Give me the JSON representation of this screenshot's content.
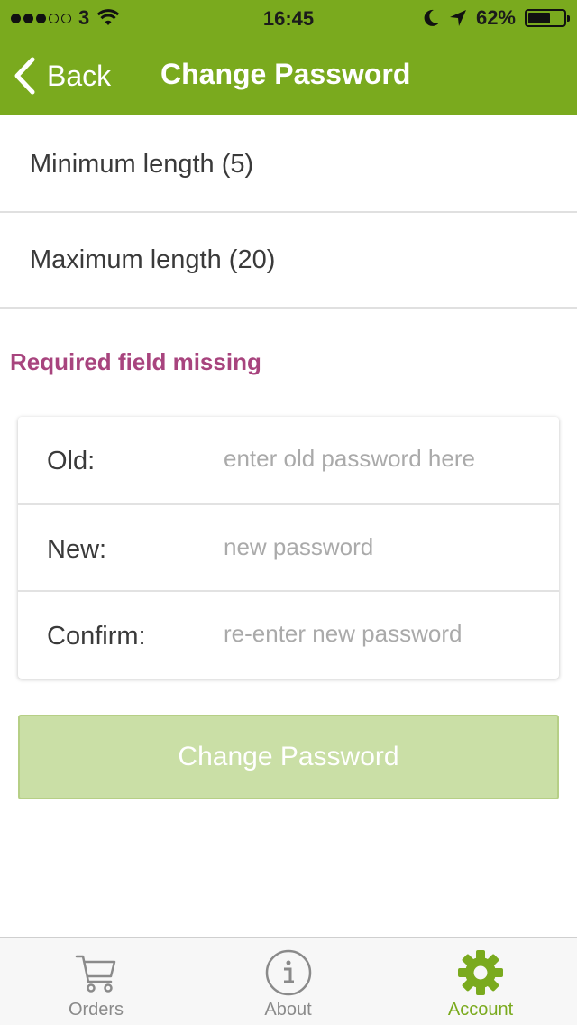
{
  "status_bar": {
    "carrier": "3",
    "time": "16:45",
    "battery_percent": "62%",
    "battery_level": 0.62,
    "signal_dots": [
      true,
      true,
      true,
      false,
      false
    ]
  },
  "nav": {
    "back_label": "Back",
    "title": "Change Password"
  },
  "rules": [
    {
      "label": "Minimum length (5)"
    },
    {
      "label": "Maximum length (20)"
    }
  ],
  "error_message": "Required field missing",
  "form": {
    "old": {
      "label": "Old:",
      "placeholder": "enter old password here"
    },
    "new": {
      "label": "New:",
      "placeholder": "new password"
    },
    "confirm": {
      "label": "Confirm:",
      "placeholder": "re-enter new password"
    }
  },
  "submit_label": "Change Password",
  "tabs": [
    {
      "label": "Orders",
      "icon": "cart-icon",
      "active": false
    },
    {
      "label": "About",
      "icon": "info-icon",
      "active": false
    },
    {
      "label": "Account",
      "icon": "gear-icon",
      "active": true
    }
  ],
  "colors": {
    "accent": "#7aaa1e",
    "error": "#a8447e",
    "button_disabled": "#cadfa6"
  }
}
